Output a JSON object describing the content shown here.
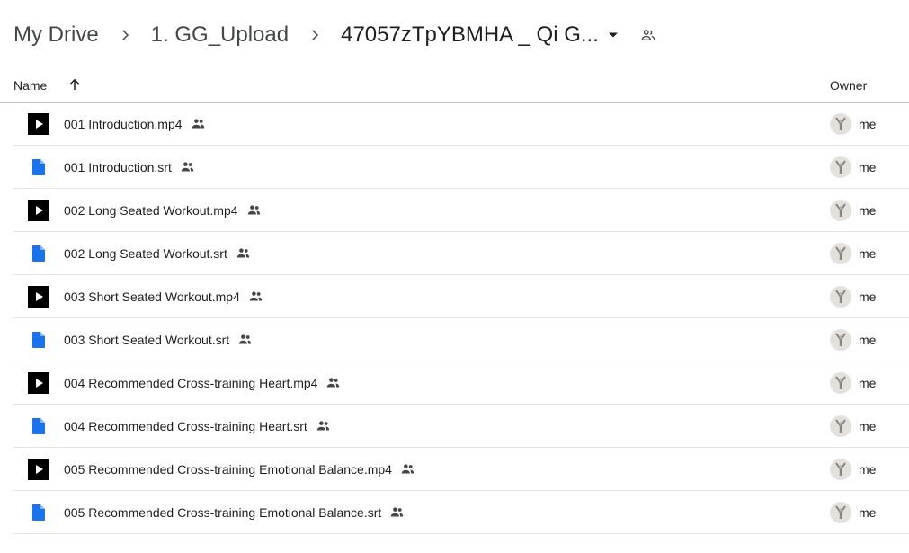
{
  "breadcrumb": {
    "root": "My Drive",
    "parent": "1. GG_Upload",
    "current": "47057zTpYBMHA _ Qi G..."
  },
  "icons": {
    "separator": "chevron-right-icon",
    "dropdown": "caret-down-icon",
    "shared": "people-icon",
    "sort": "arrow-up-icon"
  },
  "columns": {
    "name": "Name",
    "owner": "Owner",
    "sort": "ascending"
  },
  "colors": {
    "doc_blue": "#1a73e8",
    "video_thumb": "#000000",
    "text": "#1f1f1f",
    "secondary": "#444746"
  },
  "files": [
    {
      "name": "001 Introduction.mp4",
      "type": "video",
      "owner": "me"
    },
    {
      "name": "001 Introduction.srt",
      "type": "document",
      "owner": "me"
    },
    {
      "name": "002 Long Seated Workout.mp4",
      "type": "video",
      "owner": "me"
    },
    {
      "name": "002 Long Seated Workout.srt",
      "type": "document",
      "owner": "me"
    },
    {
      "name": "003 Short Seated Workout.mp4",
      "type": "video",
      "owner": "me"
    },
    {
      "name": "003 Short Seated Workout.srt",
      "type": "document",
      "owner": "me"
    },
    {
      "name": "004 Recommended Cross-training Heart.mp4",
      "type": "video",
      "owner": "me"
    },
    {
      "name": "004 Recommended Cross-training Heart.srt",
      "type": "document",
      "owner": "me"
    },
    {
      "name": "005 Recommended Cross-training Emotional Balance.mp4",
      "type": "video",
      "owner": "me"
    },
    {
      "name": "005 Recommended Cross-training Emotional Balance.srt",
      "type": "document",
      "owner": "me"
    }
  ]
}
